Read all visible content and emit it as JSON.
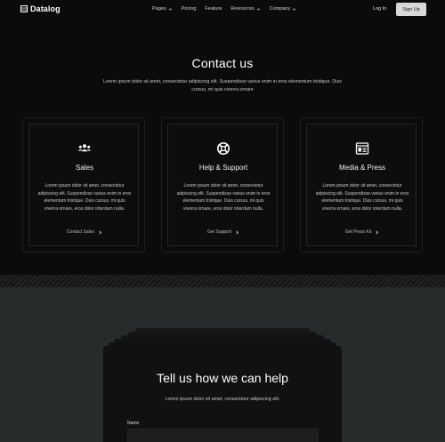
{
  "nav": {
    "brand": "Datalog",
    "menu": [
      {
        "label": "Pages",
        "has_dropdown": true
      },
      {
        "label": "Pricing",
        "has_dropdown": false
      },
      {
        "label": "Feature",
        "has_dropdown": false
      },
      {
        "label": "Resources",
        "has_dropdown": true
      },
      {
        "label": "Company",
        "has_dropdown": true
      }
    ],
    "login": "Log In",
    "signup": "Sign Up"
  },
  "hero": {
    "title": "Contact us",
    "subtitle": "Lorem ipsum dolor sit amet, consectetur adipiscing elit. Suspendisse varius enim in eros elementum tristique. Duis cursus, mi quis viverra ornare"
  },
  "cards": [
    {
      "icon": "team-icon",
      "title": "Sales",
      "text": "Lorem ipsum dolor sit amet, consectetur adipiscing elit. Suspendisse varius enim in eros elementum tristique. Duis cursus, mi quis viverra ornare, eros dolor interdum nulla.",
      "link": "Contact Sales"
    },
    {
      "icon": "lifebuoy-icon",
      "title": "Help & Support",
      "text": "Lorem ipsum dolor sit amet, consectetur adipiscing elit. Suspendisse varius enim in eros elementum tristique. Duis cursus, mi quis viverra ornare, eros dolor interdum nulla.",
      "link": "Get Support"
    },
    {
      "icon": "newspaper-icon",
      "title": "Media & Press",
      "text": "Lorem ipsum dolor sit amet, consectetur adipiscing elit. Suspendisse varius enim in eros elementum tristique. Duis cursus, mi quis viverra ornare, eros dolor interdum nulla.",
      "link": "Get Press Kit"
    }
  ],
  "help": {
    "title": "Tell us how we can help",
    "subtitle": "Lorem ipsum dolor sit amet, consectetur adipiscing elit.",
    "name_label": "Name",
    "name_value": ""
  },
  "colors": {
    "background": "#0b0b0b",
    "lower_background": "#272b2c",
    "signup_button": "#d9d9d9"
  }
}
